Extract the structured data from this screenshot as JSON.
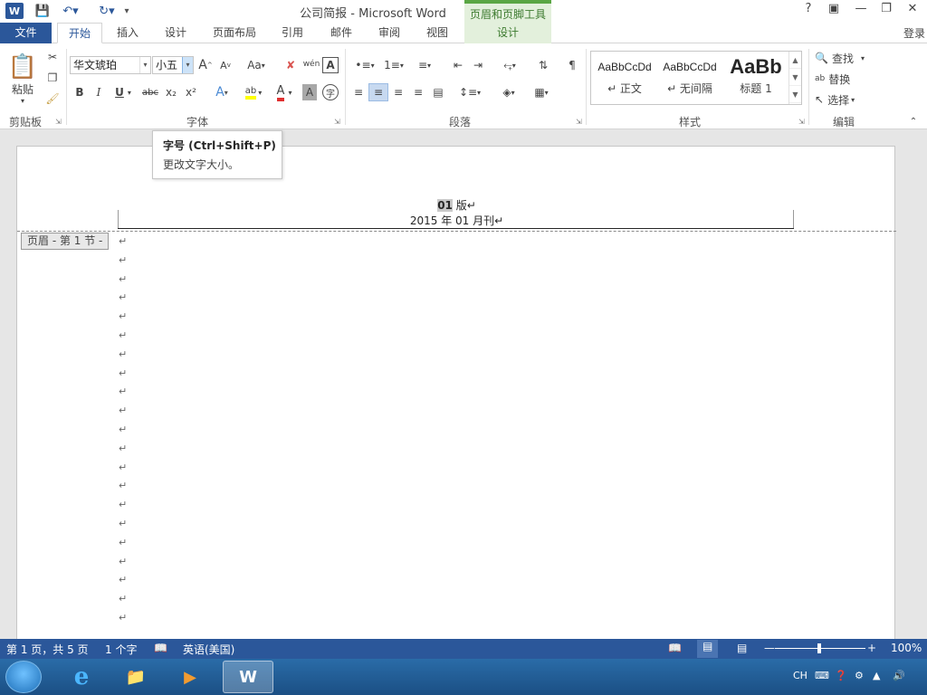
{
  "titlebar": {
    "app_icon": "W",
    "title": "公司简报 - Microsoft Word",
    "context_group": "页眉和页脚工具",
    "help": "?",
    "icons": [
      "save-icon",
      "undo-icon",
      "redo-icon",
      "customize-icon",
      "ribbon-display-icon",
      "minimize-icon",
      "restore-icon",
      "close-icon"
    ]
  },
  "tabs": {
    "file": "文件",
    "items": [
      "开始",
      "插入",
      "设计",
      "页面布局",
      "引用",
      "邮件",
      "审阅",
      "视图"
    ],
    "context": "设计",
    "login": "登录"
  },
  "ribbon": {
    "clipboard": {
      "paste": "粘贴",
      "label": "剪贴板"
    },
    "font": {
      "label": "字体",
      "font_name": "华文琥珀",
      "font_size": "小五",
      "grow": "A",
      "shrink": "A",
      "change_case": "Aa",
      "phonetic": "wén",
      "bold": "B",
      "italic": "I",
      "underline": "U",
      "strike": "abc",
      "subscript": "x₂",
      "superscript": "x²",
      "highlight": "ab",
      "font_color": "A",
      "char_shading": "A",
      "enclose": "字"
    },
    "paragraph": {
      "label": "段落"
    },
    "styles": {
      "label": "样式",
      "items": [
        {
          "sample": "AaBbCcDd",
          "name": "↵ 正文"
        },
        {
          "sample": "AaBbCcDd",
          "name": "↵ 无间隔"
        },
        {
          "sample": "AaBb",
          "name": "标题 1"
        }
      ]
    },
    "editing": {
      "label": "编辑",
      "find": "查找",
      "replace": "替换",
      "select": "选择"
    }
  },
  "tooltip": {
    "title": "字号 (Ctrl+Shift+P)",
    "desc": "更改文字大小。"
  },
  "document": {
    "header_highlight": "01",
    "header_line1_rest": " 版↵",
    "header_line2": "2015 年 01 月刊↵",
    "header_label": "页眉 - 第 1 节 -",
    "para_mark": "↵"
  },
  "statusbar": {
    "page": "第 1 页，共 5 页",
    "words": "1 个字",
    "language": "英语(美国)",
    "zoom": "100%",
    "zoom_level": 1.0
  },
  "taskbar": {
    "tray_lang": "CH"
  }
}
